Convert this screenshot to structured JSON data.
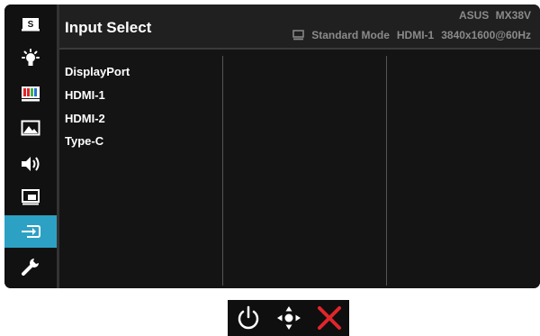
{
  "header": {
    "title": "Input Select",
    "brand": "ASUS MX38V",
    "status": {
      "mode": "Standard Mode",
      "input": "HDMI-1",
      "resolution": "3840x1600@60Hz"
    }
  },
  "sidebar": {
    "items": [
      {
        "name": "splendid",
        "icon": "splendid-s-icon",
        "label": "S"
      },
      {
        "name": "blue-light-filter",
        "icon": "bulb-icon"
      },
      {
        "name": "color",
        "icon": "color-bars-icon"
      },
      {
        "name": "image",
        "icon": "image-icon"
      },
      {
        "name": "sound",
        "icon": "speaker-icon"
      },
      {
        "name": "pip-pbp",
        "icon": "pip-icon"
      },
      {
        "name": "input-select",
        "icon": "input-icon",
        "active": true
      },
      {
        "name": "system-setup",
        "icon": "wrench-icon"
      }
    ]
  },
  "options": [
    "DisplayPort",
    "HDMI-1",
    "HDMI-2",
    "Type-C"
  ],
  "controls": [
    {
      "name": "power",
      "icon": "power-icon"
    },
    {
      "name": "navigate",
      "icon": "five-way-navigation-icon"
    },
    {
      "name": "close",
      "icon": "close-icon",
      "color": "#e0262b"
    }
  ],
  "colors": {
    "accent": "#2da1c4",
    "background": "#1a1a1a",
    "text": "#ffffff",
    "status_text": "#8a8a8a"
  }
}
